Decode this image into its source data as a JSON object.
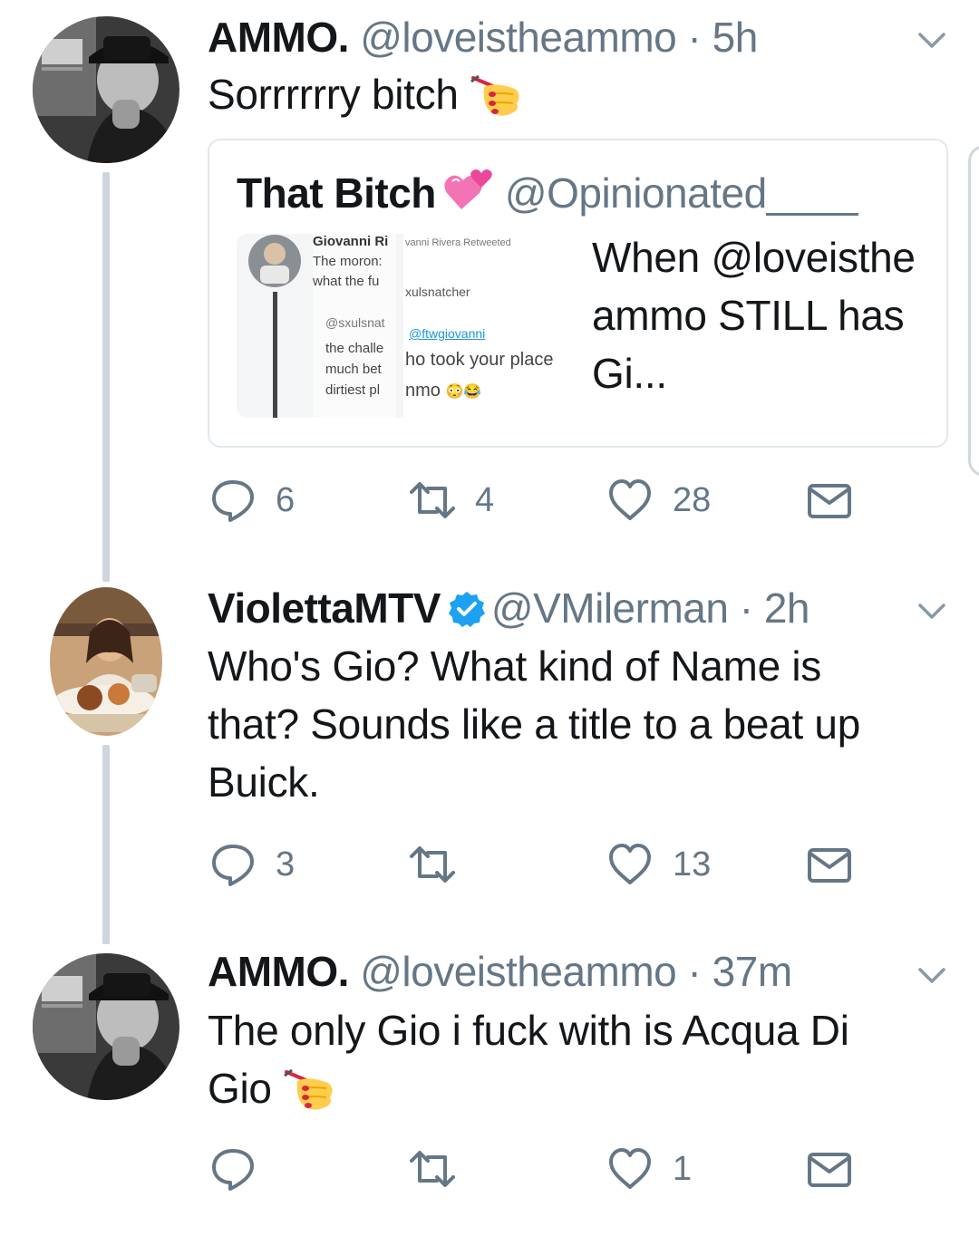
{
  "tweets": [
    {
      "name": "AMMO.",
      "handle": "@loveistheammo",
      "sep": "·",
      "time": "5h",
      "text": "Sorrrrrry bitch",
      "emoji": "nail-polish-emoji",
      "actions": {
        "reply": "6",
        "retweet": "4",
        "like": "28"
      },
      "quote": {
        "name": "That Bitch",
        "emoji": "two-hearts-emoji",
        "handle": "@Opinionated____",
        "text": "When @loveistheammo STILL has Gi...",
        "thumb": {
          "name": "Giovanni Ri",
          "line1": "The moron:",
          "line2": "what the fu",
          "rt": "vanni Rivera Retweeted",
          "user": "xulsnatcher",
          "mention1": "@sxulsnat",
          "mention2": "@ftwgiovanni",
          "body1": "the challe",
          "body2": "much bet",
          "body3": "dirtiest pl",
          "overlay1": "ho took your place",
          "overlay2": "nmo"
        }
      }
    },
    {
      "name": "ViolettaMTV",
      "handle": "@VMilerman",
      "sep": "·",
      "time": "2h",
      "verified": true,
      "text": "Who's Gio? What kind of Name is that? Sounds like a title to a beat up Buick.",
      "actions": {
        "reply": "3",
        "retweet": "",
        "like": "13"
      }
    },
    {
      "name": "AMMO.",
      "handle": "@loveistheammo",
      "sep": "·",
      "time": "37m",
      "text": "The only Gio i fuck with is Acqua Di Gio",
      "emoji": "nail-polish-emoji",
      "actions": {
        "reply": "",
        "retweet": "",
        "like": "1"
      }
    }
  ],
  "colors": {
    "text": "#14171a",
    "secondary": "#657786",
    "thread": "#ccd6dd",
    "verified": "#1da1f2",
    "border": "#e1e8ed"
  }
}
